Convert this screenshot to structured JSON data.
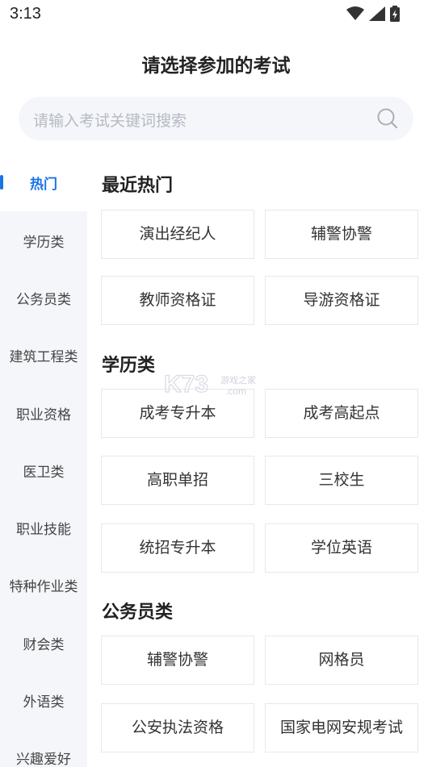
{
  "status_bar": {
    "time": "3:13"
  },
  "page": {
    "title": "请选择参加的考试"
  },
  "search": {
    "placeholder": "请输入考试关键词搜索"
  },
  "sidebar": {
    "items": [
      {
        "label": "热门",
        "active": true
      },
      {
        "label": "学历类"
      },
      {
        "label": "公务员类"
      },
      {
        "label": "建筑工程类"
      },
      {
        "label": "职业资格"
      },
      {
        "label": "医卫类"
      },
      {
        "label": "职业技能"
      },
      {
        "label": "特种作业类"
      },
      {
        "label": "财会类"
      },
      {
        "label": "外语类"
      },
      {
        "label": "兴趣爱好"
      }
    ]
  },
  "sections": [
    {
      "title": "最近热门",
      "items": [
        "演出经纪人",
        "辅警协警",
        "教师资格证",
        "导游资格证"
      ]
    },
    {
      "title": "学历类",
      "items": [
        "成考专升本",
        "成考高起点",
        "高职单招",
        "三校生",
        "统招专升本",
        "学位英语"
      ]
    },
    {
      "title": "公务员类",
      "items": [
        "辅警协警",
        "网格员",
        "公安执法资格",
        "国家电网安规考试"
      ]
    }
  ],
  "watermark": {
    "brand": "K73",
    "text1": "游戏之家",
    "text2": ".com"
  },
  "colors": {
    "accent": "#1a73e8",
    "sidebar_bg": "#f5f6fa",
    "search_bg": "#f4f6fa"
  }
}
